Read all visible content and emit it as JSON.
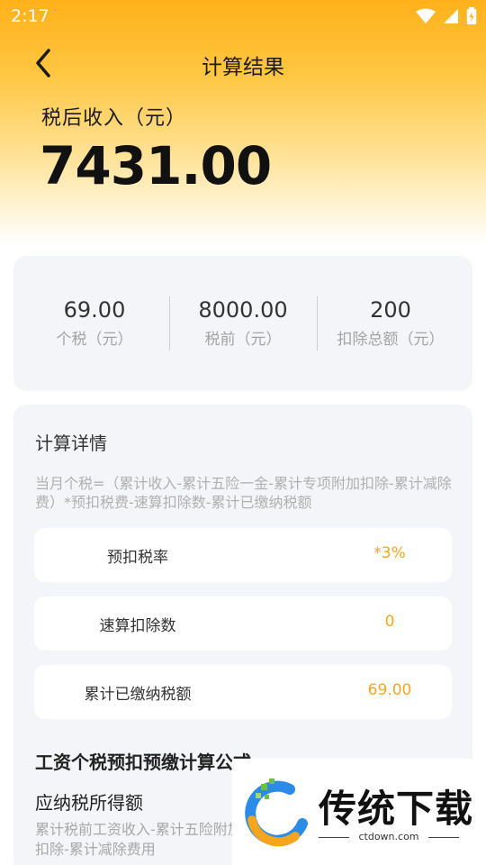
{
  "status_bar": {
    "time": "2:17"
  },
  "header": {
    "title": "计算结果"
  },
  "income": {
    "label": "税后收入（元）",
    "value": "7431.00"
  },
  "summary": [
    {
      "value": "69.00",
      "label": "个税（元）"
    },
    {
      "value": "8000.00",
      "label": "税前（元）"
    },
    {
      "value": "200",
      "label": "扣除总额（元）"
    }
  ],
  "detail": {
    "title": "计算详情",
    "formula": "当月个税=（累计收入-累计五险一金-累计专项附加扣除-累计减除费）*预扣税费-速算扣除数-累计已缴纳税额",
    "rows": [
      {
        "label": "预扣税率",
        "value": "*3%"
      },
      {
        "label": "速算扣除数",
        "value": "0"
      },
      {
        "label": "累计已缴纳税额",
        "value": "69.00"
      }
    ],
    "section_title": "工资个税预扣预缴计算公式",
    "section_subtitle": "应纳税所得额",
    "section_text": "累计税前工资收入-累计五险附加扣除-累计减除费用"
  },
  "watermark": {
    "brand": "传统下载",
    "url": "ctdown.com"
  },
  "colors": {
    "accent": "#f5a623",
    "hero_top": "#ffb11a",
    "card_bg": "#f4f5f8"
  }
}
